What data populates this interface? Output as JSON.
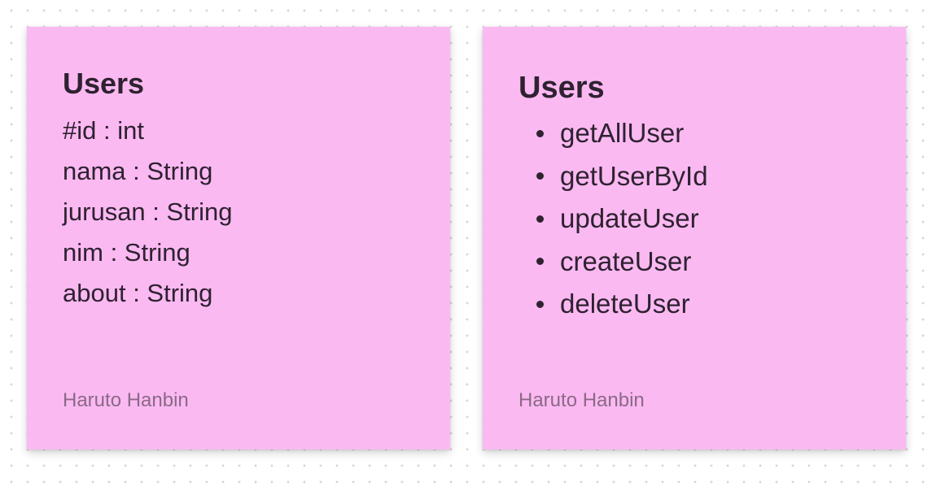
{
  "notes": [
    {
      "title": "Users",
      "attributes": [
        "#id : int",
        "nama : String",
        "jurusan : String",
        "nim : String",
        "about : String"
      ],
      "author": "Haruto Hanbin",
      "color": "#fbb9f2"
    },
    {
      "title": "Users",
      "methods": [
        "getAllUser",
        "getUserById",
        "updateUser",
        "createUser",
        "deleteUser"
      ],
      "author": "Haruto Hanbin",
      "color": "#fbb9f2"
    }
  ]
}
